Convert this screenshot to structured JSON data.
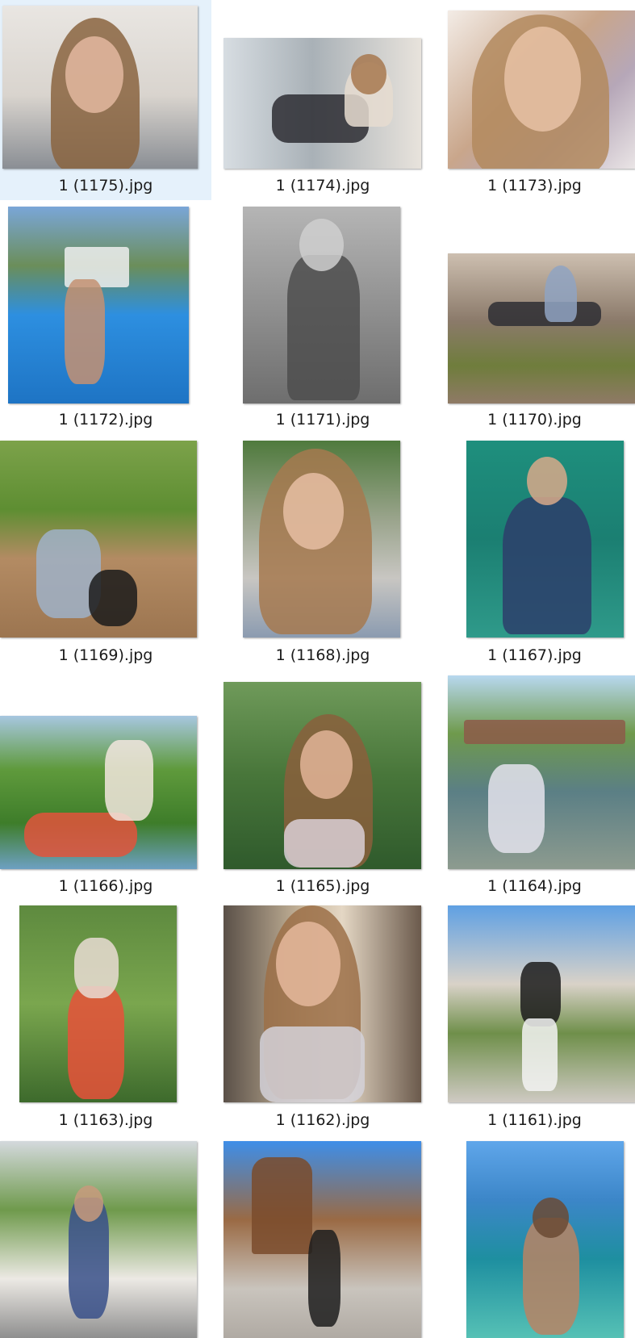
{
  "files": [
    {
      "name": "1 (1175).jpg",
      "selected": true
    },
    {
      "name": "1 (1174).jpg",
      "selected": false
    },
    {
      "name": "1 (1173).jpg",
      "selected": false
    },
    {
      "name": "1 (1172).jpg",
      "selected": false
    },
    {
      "name": "1 (1171).jpg",
      "selected": false
    },
    {
      "name": "1 (1170).jpg",
      "selected": false
    },
    {
      "name": "1 (1169).jpg",
      "selected": false
    },
    {
      "name": "1 (1168).jpg",
      "selected": false
    },
    {
      "name": "1 (1167).jpg",
      "selected": false
    },
    {
      "name": "1 (1166).jpg",
      "selected": false
    },
    {
      "name": "1 (1165).jpg",
      "selected": false
    },
    {
      "name": "1 (1164).jpg",
      "selected": false
    },
    {
      "name": "1 (1163).jpg",
      "selected": false
    },
    {
      "name": "1 (1162).jpg",
      "selected": false
    },
    {
      "name": "1 (1161).jpg",
      "selected": false
    },
    {
      "name": "",
      "selected": false
    },
    {
      "name": "",
      "selected": false
    },
    {
      "name": "",
      "selected": false
    }
  ],
  "colors": {
    "selection": "#e5f1fb",
    "caption_text": "#1a1a1a",
    "background": "#ffffff"
  }
}
